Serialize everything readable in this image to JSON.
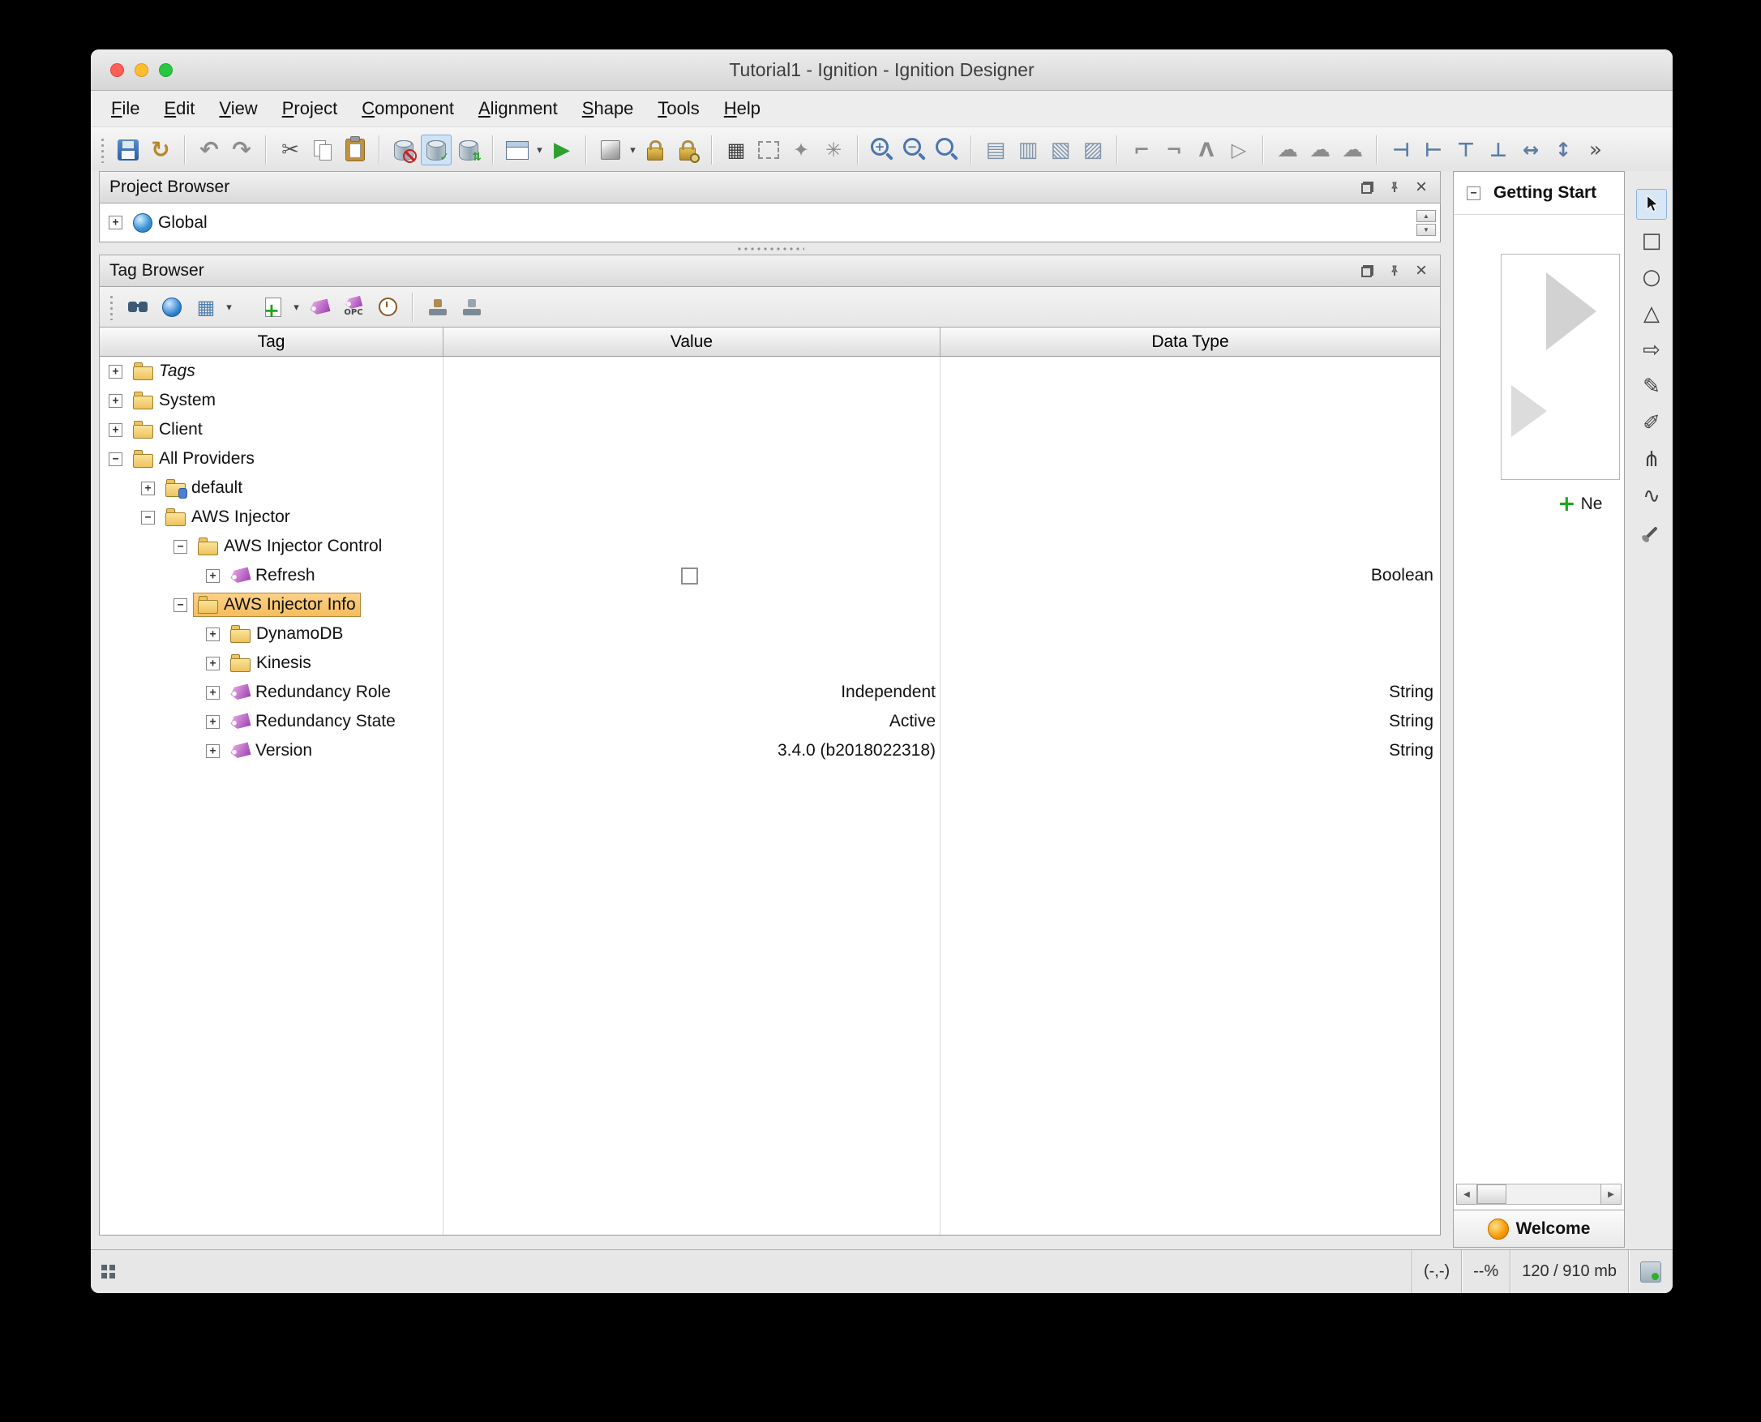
{
  "window": {
    "title": "Tutorial1 - Ignition - Ignition Designer"
  },
  "menubar": {
    "items": [
      "File",
      "Edit",
      "View",
      "Project",
      "Component",
      "Alignment",
      "Shape",
      "Tools",
      "Help"
    ]
  },
  "glyphs": {
    "caret": "▾",
    "undo": "↶",
    "redo": "↷",
    "cut": "✂",
    "refresh": "↻",
    "check": "✓",
    "sync": "⇅",
    "play": "▶",
    "matrix": "▦",
    "pointer_star": "✦",
    "burst": "✳",
    "plus": "+",
    "minus": "−",
    "z1": "▤",
    "z2": "▥",
    "z3": "▧",
    "z4": "▨",
    "rot_left": "⌐",
    "rot_right": "¬",
    "skew": "Λ",
    "flip": "▷",
    "cloud": "☁",
    "align_left": "⊣",
    "align_right": "⊢",
    "align_top": "⊤",
    "align_bottom": "⊥",
    "center_h": "↔",
    "center_v": "↕",
    "overflow": "»",
    "square": "□",
    "circle": "○",
    "triangle": "△",
    "arrow": "⇨",
    "pencil": "✎",
    "pencil2": "✐",
    "nodes": "⋔",
    "wave": "∿",
    "up": "▲",
    "down": "▼",
    "left": "◀",
    "right": "▶",
    "close": "×",
    "grid_blue": "▦",
    "opc": "OPC"
  },
  "project_browser": {
    "title": "Project Browser",
    "root": {
      "label": "Global",
      "expander": "+"
    }
  },
  "tag_browser": {
    "title": "Tag Browser",
    "columns": {
      "tag": "Tag",
      "value": "Value",
      "datatype": "Data Type"
    },
    "rows": [
      {
        "label": "Tags",
        "expander": "+"
      },
      {
        "label": "System",
        "expander": "+"
      },
      {
        "label": "Client",
        "expander": "+"
      },
      {
        "label": "All Providers",
        "expander": "−"
      },
      {
        "label": "default",
        "expander": "+"
      },
      {
        "label": "AWS Injector",
        "expander": "−"
      },
      {
        "label": "AWS Injector Control",
        "expander": "−"
      },
      {
        "label": "Refresh",
        "expander": "+",
        "value": "",
        "datatype": "Boolean"
      },
      {
        "label": "AWS Injector Info",
        "expander": "−"
      },
      {
        "label": "DynamoDB",
        "expander": "+"
      },
      {
        "label": "Kinesis",
        "expander": "+"
      },
      {
        "label": "Redundancy Role",
        "expander": "+",
        "value": "Independent",
        "datatype": "String"
      },
      {
        "label": "Redundancy State",
        "expander": "+",
        "value": "Active",
        "datatype": "String"
      },
      {
        "label": "Version",
        "expander": "+",
        "value": "3.4.0 (b2018022318)",
        "datatype": "String"
      }
    ]
  },
  "getting_started": {
    "title": "Getting Start",
    "new_link": "Ne"
  },
  "welcome_tab": {
    "label": "Welcome"
  },
  "statusbar": {
    "coords": "(-,-)",
    "zoom": "--%",
    "memory": "120 / 910 mb"
  }
}
